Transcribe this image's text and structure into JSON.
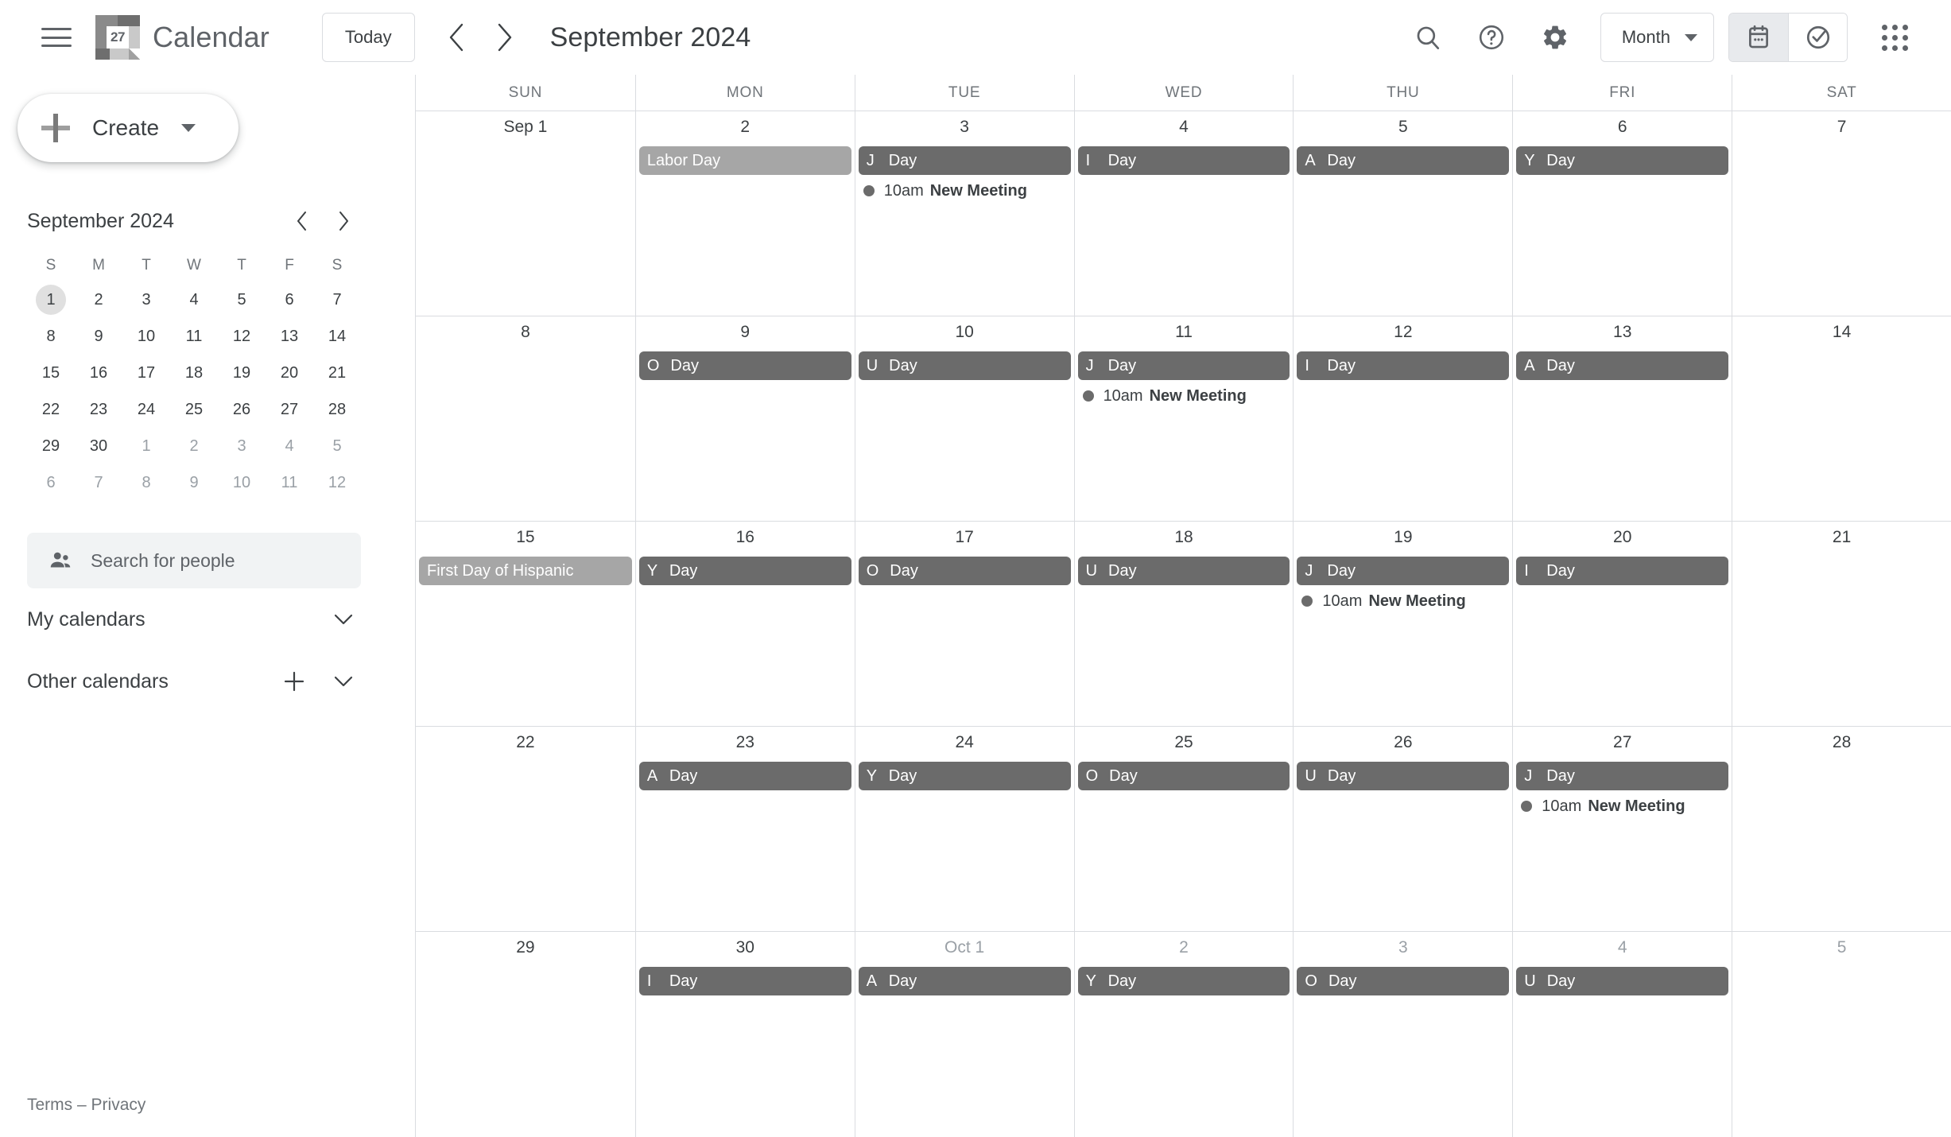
{
  "app": {
    "logo_day": "27",
    "title": "Calendar"
  },
  "toolbar": {
    "menu_label": "Main menu",
    "today_label": "Today",
    "prev_label": "Previous month",
    "next_label": "Next month",
    "period_title": "September 2024",
    "search_label": "Search",
    "help_label": "Support",
    "settings_label": "Settings menu",
    "view_value": "Month",
    "view_calendar_label": "Calendar view",
    "view_tasks_label": "Tasks view",
    "apps_label": "Google apps"
  },
  "sidebar": {
    "create_label": "Create",
    "mini_calendar": {
      "title": "September 2024",
      "dow": [
        "S",
        "M",
        "T",
        "W",
        "T",
        "F",
        "S"
      ],
      "weeks": [
        [
          {
            "n": "1",
            "muted": false,
            "today": true
          },
          {
            "n": "2",
            "muted": false,
            "today": false
          },
          {
            "n": "3",
            "muted": false,
            "today": false
          },
          {
            "n": "4",
            "muted": false,
            "today": false
          },
          {
            "n": "5",
            "muted": false,
            "today": false
          },
          {
            "n": "6",
            "muted": false,
            "today": false
          },
          {
            "n": "7",
            "muted": false,
            "today": false
          }
        ],
        [
          {
            "n": "8",
            "muted": false,
            "today": false
          },
          {
            "n": "9",
            "muted": false,
            "today": false
          },
          {
            "n": "10",
            "muted": false,
            "today": false
          },
          {
            "n": "11",
            "muted": false,
            "today": false
          },
          {
            "n": "12",
            "muted": false,
            "today": false
          },
          {
            "n": "13",
            "muted": false,
            "today": false
          },
          {
            "n": "14",
            "muted": false,
            "today": false
          }
        ],
        [
          {
            "n": "15",
            "muted": false,
            "today": false
          },
          {
            "n": "16",
            "muted": false,
            "today": false
          },
          {
            "n": "17",
            "muted": false,
            "today": false
          },
          {
            "n": "18",
            "muted": false,
            "today": false
          },
          {
            "n": "19",
            "muted": false,
            "today": false
          },
          {
            "n": "20",
            "muted": false,
            "today": false
          },
          {
            "n": "21",
            "muted": false,
            "today": false
          }
        ],
        [
          {
            "n": "22",
            "muted": false,
            "today": false
          },
          {
            "n": "23",
            "muted": false,
            "today": false
          },
          {
            "n": "24",
            "muted": false,
            "today": false
          },
          {
            "n": "25",
            "muted": false,
            "today": false
          },
          {
            "n": "26",
            "muted": false,
            "today": false
          },
          {
            "n": "27",
            "muted": false,
            "today": false
          },
          {
            "n": "28",
            "muted": false,
            "today": false
          }
        ],
        [
          {
            "n": "29",
            "muted": false,
            "today": false
          },
          {
            "n": "30",
            "muted": false,
            "today": false
          },
          {
            "n": "1",
            "muted": true,
            "today": false
          },
          {
            "n": "2",
            "muted": true,
            "today": false
          },
          {
            "n": "3",
            "muted": true,
            "today": false
          },
          {
            "n": "4",
            "muted": true,
            "today": false
          },
          {
            "n": "5",
            "muted": true,
            "today": false
          }
        ],
        [
          {
            "n": "6",
            "muted": true,
            "today": false
          },
          {
            "n": "7",
            "muted": true,
            "today": false
          },
          {
            "n": "8",
            "muted": true,
            "today": false
          },
          {
            "n": "9",
            "muted": true,
            "today": false
          },
          {
            "n": "10",
            "muted": true,
            "today": false
          },
          {
            "n": "11",
            "muted": true,
            "today": false
          },
          {
            "n": "12",
            "muted": true,
            "today": false
          }
        ]
      ]
    },
    "people_search_placeholder": "Search for people",
    "my_calendars_label": "My calendars",
    "other_calendars_label": "Other calendars",
    "add_other_calendar_label": "Add other calendars",
    "footer": {
      "terms": "Terms",
      "separator": "–",
      "privacy": "Privacy"
    }
  },
  "calendar": {
    "day_headers": [
      "SUN",
      "MON",
      "TUE",
      "WED",
      "THU",
      "FRI",
      "SAT"
    ],
    "colors": {
      "holiday_chip": "#a6a6a6",
      "event_chip": "#6b6b6b",
      "timed_dot": "#6b6b6b",
      "grid_line": "#dadce0"
    },
    "weeks": [
      [
        {
          "num": "Sep 1",
          "muted": false,
          "events": []
        },
        {
          "num": "2",
          "muted": false,
          "events": [
            {
              "kind": "holiday",
              "initial": "",
              "text": "Labor Day"
            }
          ]
        },
        {
          "num": "3",
          "muted": false,
          "events": [
            {
              "kind": "event",
              "initial": "J",
              "text": "Day"
            },
            {
              "kind": "timed",
              "time": "10am",
              "text": "New Meeting"
            }
          ]
        },
        {
          "num": "4",
          "muted": false,
          "events": [
            {
              "kind": "event",
              "initial": "I",
              "text": "Day"
            }
          ]
        },
        {
          "num": "5",
          "muted": false,
          "events": [
            {
              "kind": "event",
              "initial": "A",
              "text": "Day"
            }
          ]
        },
        {
          "num": "6",
          "muted": false,
          "events": [
            {
              "kind": "event",
              "initial": "Y",
              "text": "Day"
            }
          ]
        },
        {
          "num": "7",
          "muted": false,
          "events": []
        }
      ],
      [
        {
          "num": "8",
          "muted": false,
          "events": []
        },
        {
          "num": "9",
          "muted": false,
          "events": [
            {
              "kind": "event",
              "initial": "O",
              "text": "Day"
            }
          ]
        },
        {
          "num": "10",
          "muted": false,
          "events": [
            {
              "kind": "event",
              "initial": "U",
              "text": "Day"
            }
          ]
        },
        {
          "num": "11",
          "muted": false,
          "events": [
            {
              "kind": "event",
              "initial": "J",
              "text": "Day"
            },
            {
              "kind": "timed",
              "time": "10am",
              "text": "New Meeting"
            }
          ]
        },
        {
          "num": "12",
          "muted": false,
          "events": [
            {
              "kind": "event",
              "initial": "I",
              "text": "Day"
            }
          ]
        },
        {
          "num": "13",
          "muted": false,
          "events": [
            {
              "kind": "event",
              "initial": "A",
              "text": "Day"
            }
          ]
        },
        {
          "num": "14",
          "muted": false,
          "events": []
        }
      ],
      [
        {
          "num": "15",
          "muted": false,
          "events": [
            {
              "kind": "holiday",
              "initial": "",
              "text": "First Day of Hispanic"
            }
          ]
        },
        {
          "num": "16",
          "muted": false,
          "events": [
            {
              "kind": "event",
              "initial": "Y",
              "text": "Day"
            }
          ]
        },
        {
          "num": "17",
          "muted": false,
          "events": [
            {
              "kind": "event",
              "initial": "O",
              "text": "Day"
            }
          ]
        },
        {
          "num": "18",
          "muted": false,
          "events": [
            {
              "kind": "event",
              "initial": "U",
              "text": "Day"
            }
          ]
        },
        {
          "num": "19",
          "muted": false,
          "events": [
            {
              "kind": "event",
              "initial": "J",
              "text": "Day"
            },
            {
              "kind": "timed",
              "time": "10am",
              "text": "New Meeting"
            }
          ]
        },
        {
          "num": "20",
          "muted": false,
          "events": [
            {
              "kind": "event",
              "initial": "I",
              "text": "Day"
            }
          ]
        },
        {
          "num": "21",
          "muted": false,
          "events": []
        }
      ],
      [
        {
          "num": "22",
          "muted": false,
          "events": []
        },
        {
          "num": "23",
          "muted": false,
          "events": [
            {
              "kind": "event",
              "initial": "A",
              "text": "Day"
            }
          ]
        },
        {
          "num": "24",
          "muted": false,
          "events": [
            {
              "kind": "event",
              "initial": "Y",
              "text": "Day"
            }
          ]
        },
        {
          "num": "25",
          "muted": false,
          "events": [
            {
              "kind": "event",
              "initial": "O",
              "text": "Day"
            }
          ]
        },
        {
          "num": "26",
          "muted": false,
          "events": [
            {
              "kind": "event",
              "initial": "U",
              "text": "Day"
            }
          ]
        },
        {
          "num": "27",
          "muted": false,
          "events": [
            {
              "kind": "event",
              "initial": "J",
              "text": "Day"
            },
            {
              "kind": "timed",
              "time": "10am",
              "text": "New Meeting"
            }
          ]
        },
        {
          "num": "28",
          "muted": false,
          "events": []
        }
      ],
      [
        {
          "num": "29",
          "muted": false,
          "events": []
        },
        {
          "num": "30",
          "muted": false,
          "events": [
            {
              "kind": "event",
              "initial": "I",
              "text": "Day"
            }
          ]
        },
        {
          "num": "Oct 1",
          "muted": true,
          "events": [
            {
              "kind": "event",
              "initial": "A",
              "text": "Day"
            }
          ]
        },
        {
          "num": "2",
          "muted": true,
          "events": [
            {
              "kind": "event",
              "initial": "Y",
              "text": "Day"
            }
          ]
        },
        {
          "num": "3",
          "muted": true,
          "events": [
            {
              "kind": "event",
              "initial": "O",
              "text": "Day"
            }
          ]
        },
        {
          "num": "4",
          "muted": true,
          "events": [
            {
              "kind": "event",
              "initial": "U",
              "text": "Day"
            }
          ]
        },
        {
          "num": "5",
          "muted": true,
          "events": []
        }
      ]
    ]
  }
}
